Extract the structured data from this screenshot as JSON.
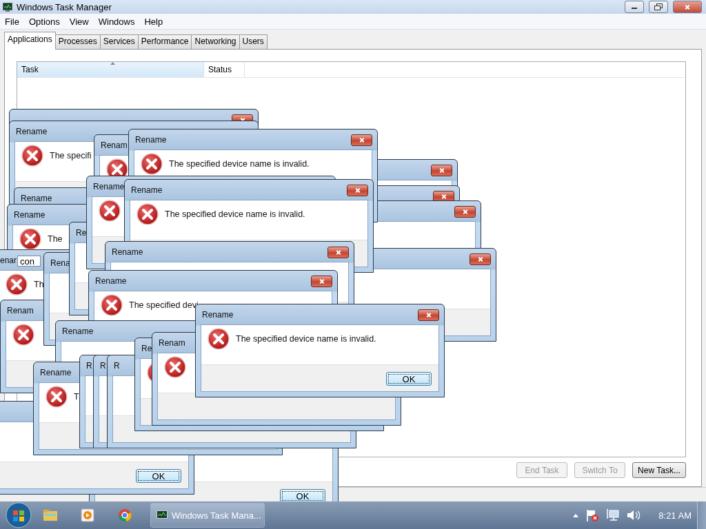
{
  "window": {
    "title": "Windows Task Manager"
  },
  "menu": [
    "File",
    "Options",
    "View",
    "Windows",
    "Help"
  ],
  "tabs": [
    {
      "label": "Applications",
      "selected": true
    },
    {
      "label": "Processes",
      "selected": false
    },
    {
      "label": "Services",
      "selected": false
    },
    {
      "label": "Performance",
      "selected": false
    },
    {
      "label": "Networking",
      "selected": false
    },
    {
      "label": "Users",
      "selected": false
    }
  ],
  "table": {
    "columns": [
      {
        "label": "Task",
        "sorted": true
      },
      {
        "label": "Status",
        "sorted": false
      }
    ]
  },
  "buttons": [
    {
      "label": "End Task",
      "disabled": true
    },
    {
      "label": "Switch To",
      "disabled": true
    },
    {
      "label": "New Task...",
      "disabled": false
    }
  ],
  "dialogs": [
    {
      "ok": "OK"
    },
    {
      "ok": "OK"
    },
    {
      "close": true
    },
    {
      "close": true
    },
    {
      "close": true
    },
    {
      "close": true
    },
    {
      "close": true
    },
    {
      "title": "Rename",
      "message": "The specifi",
      "icon": true
    },
    {
      "title": "Renam",
      "icon": true
    },
    {
      "title": "Rename",
      "message": "The specified device name is invalid.",
      "icon": true,
      "close": true
    },
    {
      "title": "Rename"
    },
    {
      "title": "Rename",
      "message": "The",
      "icon": true
    },
    {
      "title": "enar",
      "field": "con",
      "message": "Th",
      "icon": true
    },
    {
      "title": "Renam",
      "icon": true
    },
    {
      "title": "Rena"
    },
    {
      "title": "Re"
    },
    {
      "title": "Rename",
      "icon": true
    },
    {
      "title": "Rename",
      "message": "The specified device name is invalid.",
      "icon": true,
      "close": true
    },
    {
      "title": "Rename",
      "close": true
    },
    {
      "title": "Rename",
      "message": "The specified devi",
      "icon": true,
      "close": true
    },
    {
      "title": "Rename"
    },
    {
      "title": "Rename",
      "message": "T",
      "icon": true
    },
    {
      "title": "R"
    },
    {
      "title": "R"
    },
    {
      "title": "R"
    },
    {
      "title": "Re",
      "icon": true
    },
    {
      "title": "Renam",
      "icon": true
    },
    {
      "title": "Rename",
      "message": "The specified device name is invalid.",
      "ok": "OK",
      "icon": true,
      "close": true
    }
  ],
  "taskbar": {
    "task_button": "Windows Task Mana...",
    "clock": "8:21 AM"
  }
}
